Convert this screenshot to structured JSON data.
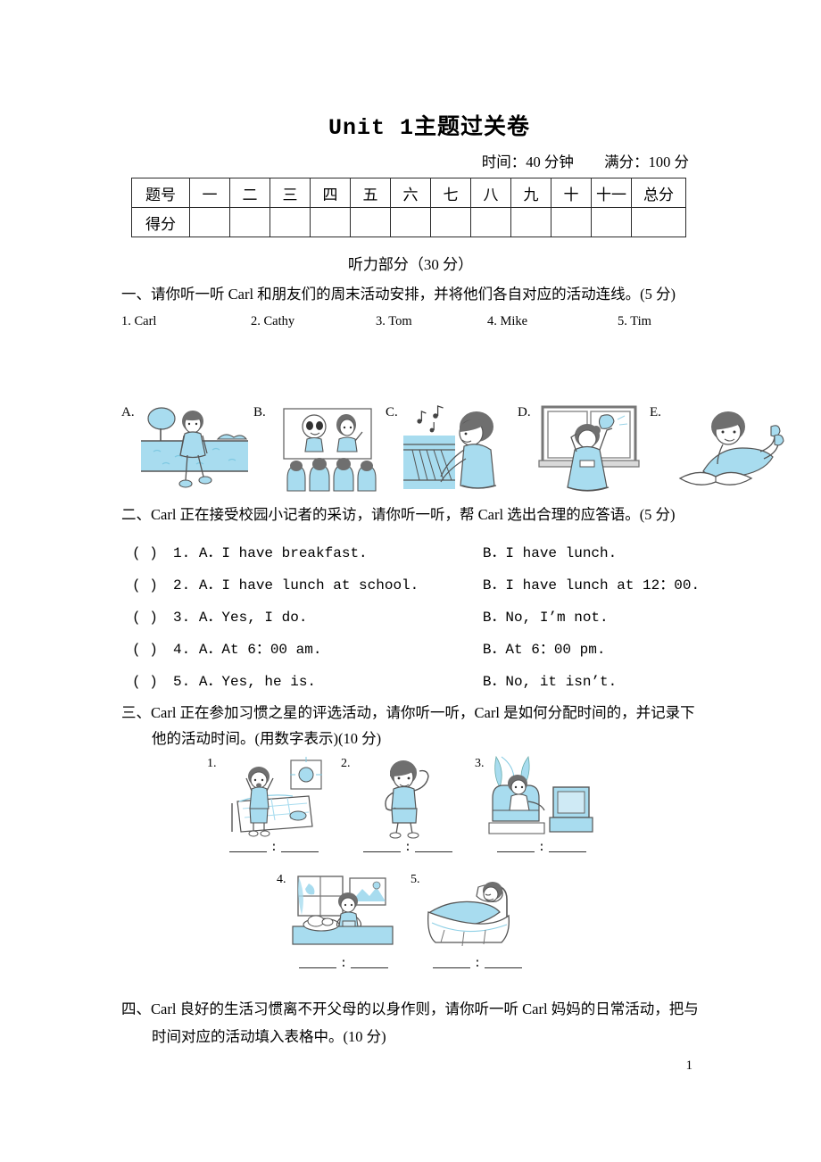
{
  "document": {
    "title": "Unit 1主题过关卷",
    "time_label": "时间：40 分钟",
    "score_label": "满分：100 分",
    "page_number": "1"
  },
  "score_table": {
    "row_labels": [
      "题号",
      "得分"
    ],
    "columns": [
      "一",
      "二",
      "三",
      "四",
      "五",
      "六",
      "七",
      "八",
      "九",
      "十",
      "十一"
    ],
    "total_label": "总分",
    "score_values": [
      "",
      "",
      "",
      "",
      "",
      "",
      "",
      "",
      "",
      "",
      "",
      ""
    ]
  },
  "listening_part": {
    "heading": "听力部分（30 分）"
  },
  "section_one": {
    "prompt": "一、请你听一听 Carl 和朋友们的周末活动安排，并将他们各自对应的活动连线。(5 分)",
    "names": [
      {
        "label": "1. Carl"
      },
      {
        "label": "2. Cathy"
      },
      {
        "label": "3. Tom"
      },
      {
        "label": "4. Mike"
      },
      {
        "label": "5. Tim"
      }
    ],
    "pictures": [
      {
        "label": "A.",
        "icon": "person-walking-by-water-icon"
      },
      {
        "label": "B.",
        "icon": "watching-movie-theatre-icon"
      },
      {
        "label": "C.",
        "icon": "playing-piano-icon"
      },
      {
        "label": "D.",
        "icon": "cleaning-window-icon"
      },
      {
        "label": "E.",
        "icon": "reading-book-lying-down-icon"
      }
    ]
  },
  "section_two": {
    "prompt": "二、Carl 正在接受校园小记者的采访，请你听一听，帮 Carl 选出合理的应答语。(5 分)",
    "items": [
      {
        "number": "1.",
        "paren": "(    )",
        "option_a": "A．I have breakfast.",
        "option_b": "B．I have lunch."
      },
      {
        "number": "2.",
        "paren": "(    )",
        "option_a": "A．I have lunch at school.",
        "option_b": "B．I have lunch at 12：00."
      },
      {
        "number": "3.",
        "paren": "(    )",
        "option_a": "A．Yes, I do.",
        "option_b": "B．No, I’m not."
      },
      {
        "number": "4.",
        "paren": "(    )",
        "option_a": "A．At 6：00 am.",
        "option_b": "B．At 6：00 pm."
      },
      {
        "number": "5.",
        "paren": "(    )",
        "option_a": "A．Yes, he is.",
        "option_b": "B．No, it isn’t."
      }
    ]
  },
  "section_three": {
    "prompt_line1": "三、Carl 正在参加习惯之星的评选活动，请你听一听，Carl 是如何分配时间的，并记录下",
    "prompt_line2": "他的活动时间。(用数字表示)(10 分)",
    "items": [
      {
        "number": "1.",
        "icon": "waking-up-stretching-icon",
        "answer": ""
      },
      {
        "number": "2.",
        "icon": "doing-exercise-icon",
        "answer": ""
      },
      {
        "number": "3.",
        "icon": "watching-tv-icon",
        "answer": ""
      },
      {
        "number": "4.",
        "icon": "having-dinner-icon",
        "answer": ""
      },
      {
        "number": "5.",
        "icon": "sleeping-in-bed-icon",
        "answer": ""
      }
    ]
  },
  "section_four": {
    "prompt_line1": "四、Carl 良好的生活习惯离不开父母的以身作则，请你听一听 Carl 妈妈的日常活动，把与",
    "prompt_line2": "时间对应的活动填入表格中。(10 分)"
  },
  "colors": {
    "illustration_fill": "#a8dcef",
    "illustration_line": "#444444",
    "hair": "#6f6f6f",
    "table_border": "#2b2b2b",
    "text": "#000000"
  }
}
